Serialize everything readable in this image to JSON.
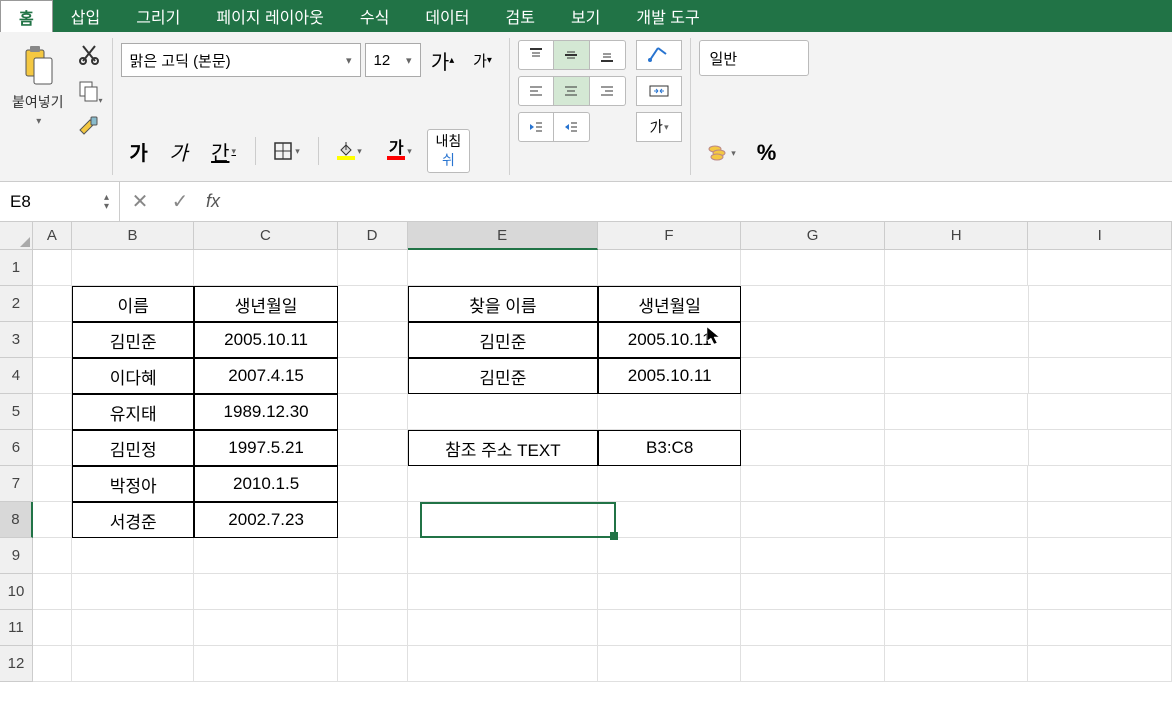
{
  "tabs": [
    "홈",
    "삽입",
    "그리기",
    "페이지 레이아웃",
    "수식",
    "데이터",
    "검토",
    "보기",
    "개발 도구"
  ],
  "active_tab": 0,
  "ribbon": {
    "paste_label": "붙여넣기",
    "font_name": "맑은 고딕 (본문)",
    "font_size": "12",
    "bold": "가",
    "italic": "가",
    "underline": "간",
    "font_grow": "가",
    "font_shrink": "가",
    "fill_char": "가",
    "font_color_char": "가",
    "wrap_label": "내침",
    "wrap_label2": "쉬",
    "number_format": "일반"
  },
  "formula_bar": {
    "name_box": "E8",
    "formula": ""
  },
  "columns": [
    "A",
    "B",
    "C",
    "D",
    "E",
    "F",
    "G",
    "H",
    "I"
  ],
  "col_widths": [
    "c-A",
    "c-B",
    "c-C",
    "c-D",
    "c-E",
    "c-F",
    "c-G",
    "c-H",
    "c-I"
  ],
  "rows": [
    1,
    2,
    3,
    4,
    5,
    6,
    7,
    8,
    9,
    10,
    11,
    12
  ],
  "cells": {
    "B2": "이름",
    "C2": "생년월일",
    "B3": "김민준",
    "C3": "2005.10.11",
    "B4": "이다혜",
    "C4": "2007.4.15",
    "B5": "유지태",
    "C5": "1989.12.30",
    "B6": "김민정",
    "C6": "1997.5.21",
    "B7": "박정아",
    "C7": "2010.1.5",
    "B8": "서경준",
    "C8": "2002.7.23",
    "E2": "찾을 이름",
    "F2": "생년월일",
    "E3": "김민준",
    "F3": "2005.10.11",
    "E4": "김민준",
    "F4": "2005.10.11",
    "E6": "참조 주소 TEXT",
    "F6": "B3:C8"
  },
  "selected_cell": "E8",
  "selected_col": "E",
  "selected_row": 8
}
